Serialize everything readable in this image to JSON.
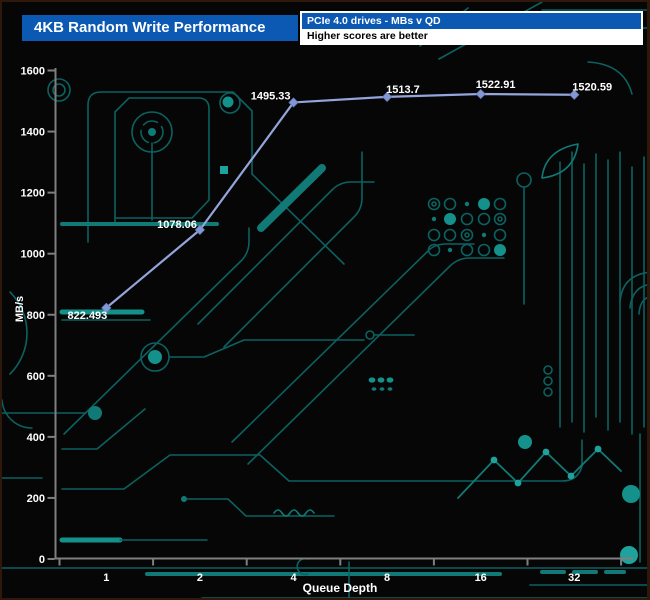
{
  "header": {
    "title": "4KB Random Write Performance",
    "info_primary": "PCIe 4.0 drives - MBs v QD",
    "info_secondary": "Higher scores are better"
  },
  "colors": {
    "header_blue": "#0b59b2",
    "info_border": "#ffffff",
    "series_line": "#94a5db",
    "marker_fill": "#8397d3",
    "marker_edge": "#6c80c2",
    "axis_gray": "#7f7f7f",
    "text_white": "#ffffff",
    "circuit_teal_dim": "#0c6161",
    "circuit_teal_mid": "#117a76",
    "circuit_teal_bright": "#1fa29b",
    "background": "#060606"
  },
  "chart_data": {
    "type": "line",
    "title": "4KB Random Write Performance",
    "subtitle": "PCIe 4.0 drives - MBs v QD",
    "note": "Higher scores are better",
    "xlabel": "Queue Depth",
    "ylabel": "MB/s",
    "categories": [
      "1",
      "2",
      "4",
      "8",
      "16",
      "32"
    ],
    "series": [
      {
        "values": [
          822.493,
          1078.06,
          1495.33,
          1513.7,
          1522.91,
          1520.59
        ]
      }
    ],
    "point_labels": [
      "822.493",
      "1078.06",
      "1495.33",
      "1513.7",
      "1522.91",
      "1520.59"
    ],
    "ylim": [
      0,
      1600
    ],
    "yticks": [
      0,
      200,
      400,
      600,
      800,
      1000,
      1200,
      1400,
      1600
    ],
    "grid": false,
    "legend": "none"
  }
}
